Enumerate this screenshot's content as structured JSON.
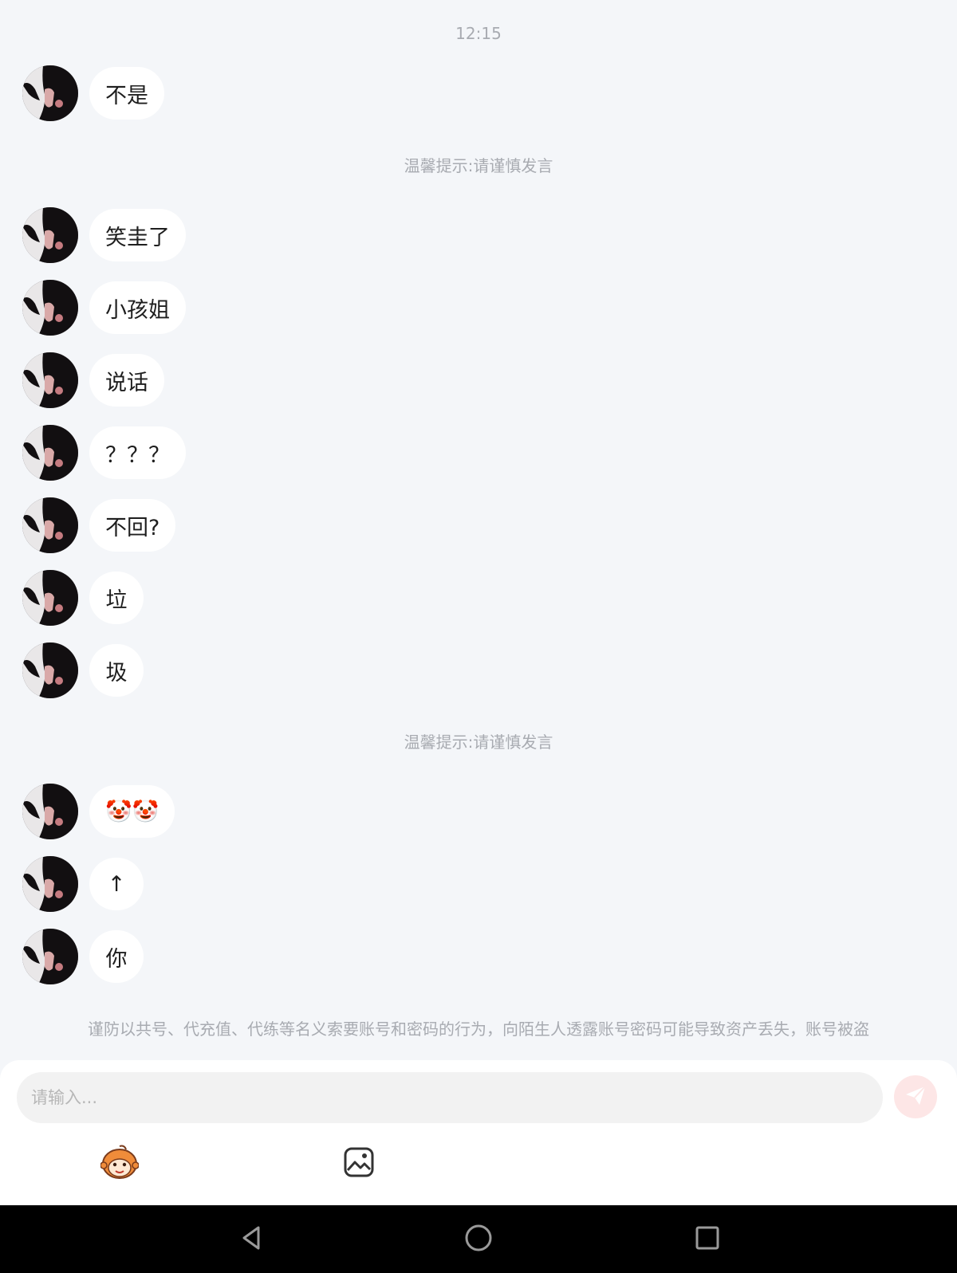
{
  "chat": {
    "timestamp": "12:15",
    "notice": "温馨提示:请谨慎发言",
    "messages": [
      {
        "text": "不是"
      },
      {
        "text": "笑圭了"
      },
      {
        "text": "小孩姐"
      },
      {
        "text": "说话"
      },
      {
        "text": "？？？"
      },
      {
        "text": "不回?"
      },
      {
        "text": "垃"
      },
      {
        "text": "圾"
      },
      {
        "text": "🤡🤡"
      },
      {
        "text": "↑"
      },
      {
        "text": "你"
      }
    ],
    "warning": "谨防以共号、代充值、代练等名义索要账号和密码的行为，向陌生人透露账号密码可能导致资产丢失，账号被盗"
  },
  "composer": {
    "placeholder": "请输入...",
    "send_icon": "paper-plane-icon",
    "tools": [
      "emoji-mascot-icon",
      "image-icon"
    ]
  },
  "nav": {
    "buttons": [
      "back-triangle-icon",
      "home-circle-icon",
      "recents-square-icon"
    ]
  },
  "colors": {
    "background": "#f4f6f9",
    "bubble": "#ffffff",
    "send_button": "#fde6e6",
    "send_icon": "#ffffff",
    "hint_text": "#a8abb1"
  }
}
